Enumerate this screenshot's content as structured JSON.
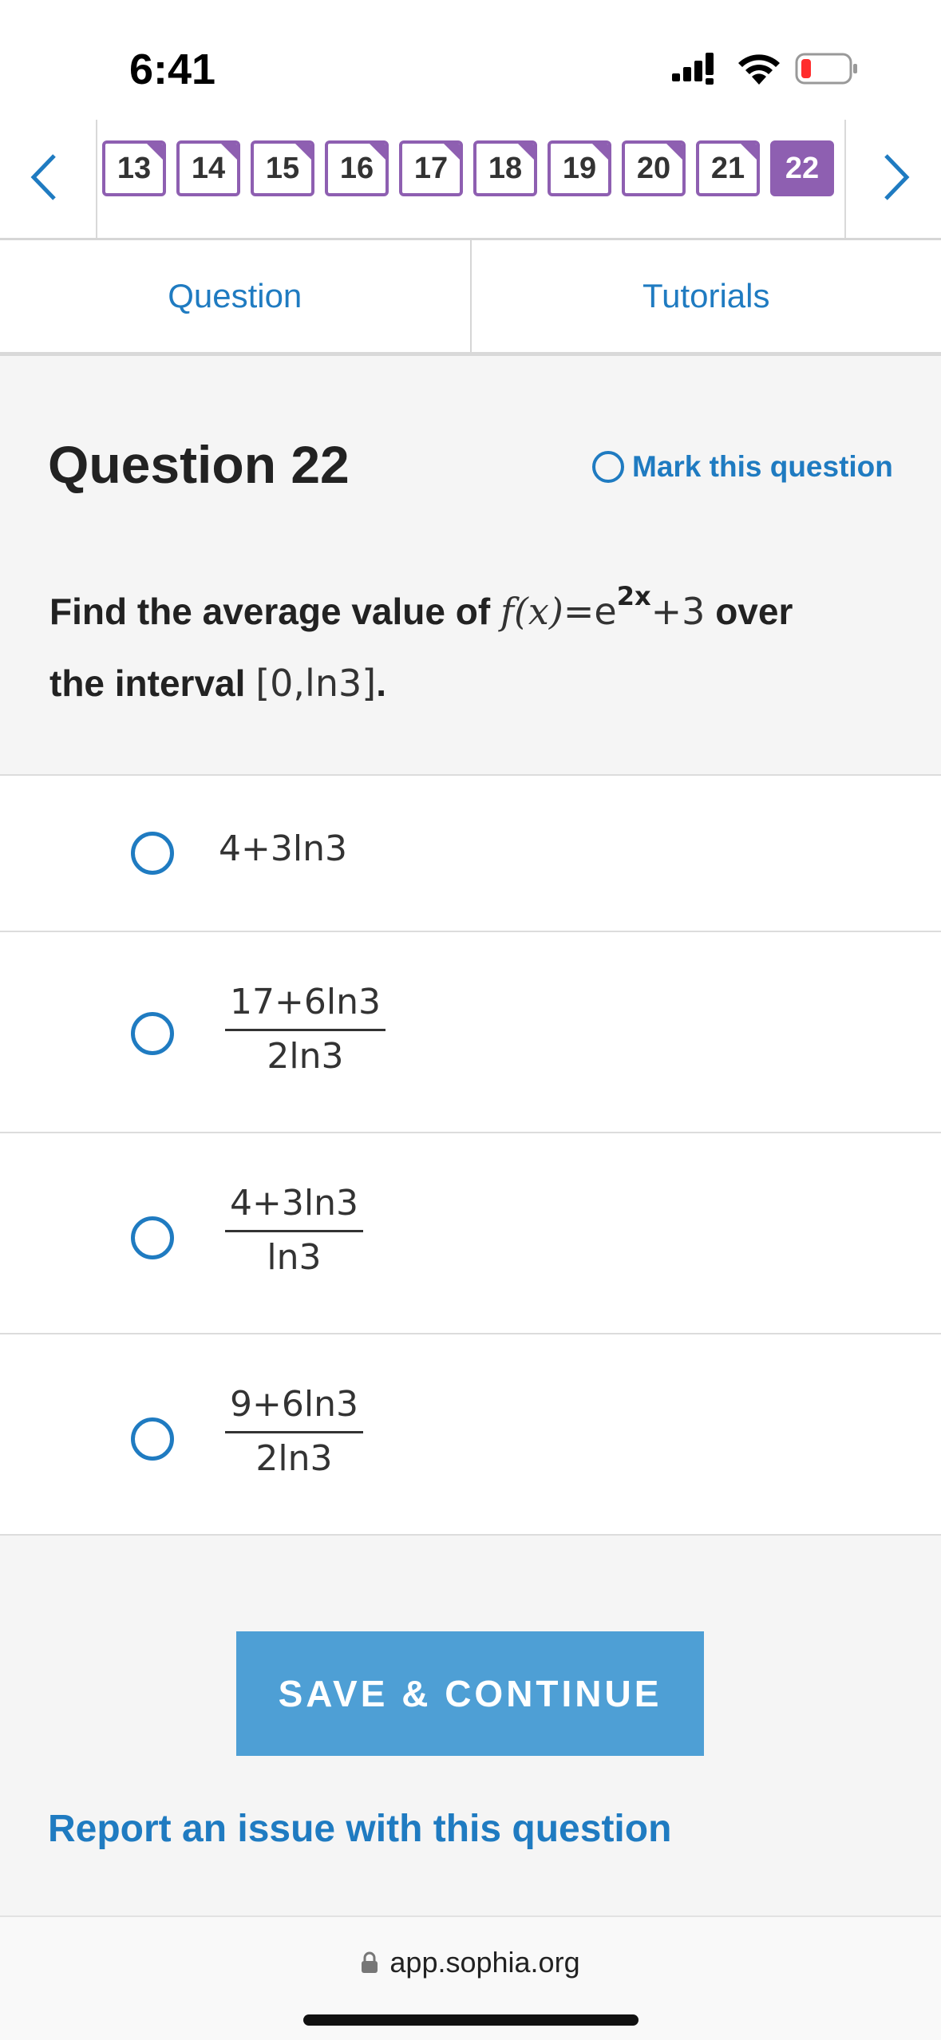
{
  "status": {
    "time": "6:41"
  },
  "nav": {
    "numbers": [
      "13",
      "14",
      "15",
      "16",
      "17",
      "18",
      "19",
      "20",
      "21",
      "22"
    ],
    "active": "22"
  },
  "tabs": {
    "question": "Question",
    "tutorials": "Tutorials"
  },
  "question": {
    "title": "Question 22",
    "mark_label": "Mark this question",
    "text_prefix": "Find the average value of",
    "fx": "f(x)",
    "eq": "=",
    "base": "e",
    "exponent": "2x",
    "plus3": "+3",
    "text_mid": "over",
    "text_line2": "the interval",
    "interval": "[0,ln3]",
    "period": "."
  },
  "options": [
    {
      "inline": "4+3ln3"
    },
    {
      "num": "17+6ln3",
      "den": "2ln3"
    },
    {
      "num": "4+3ln3",
      "den": "ln3"
    },
    {
      "num": "9+6ln3",
      "den": "2ln3"
    }
  ],
  "actions": {
    "save": "SAVE & CONTINUE",
    "report": "Report an issue with this question"
  },
  "browser": {
    "url": "app.sophia.org"
  },
  "colors": {
    "accent": "#1f7bc1",
    "purple": "#8e5fb1",
    "button": "#4e9fd5"
  }
}
